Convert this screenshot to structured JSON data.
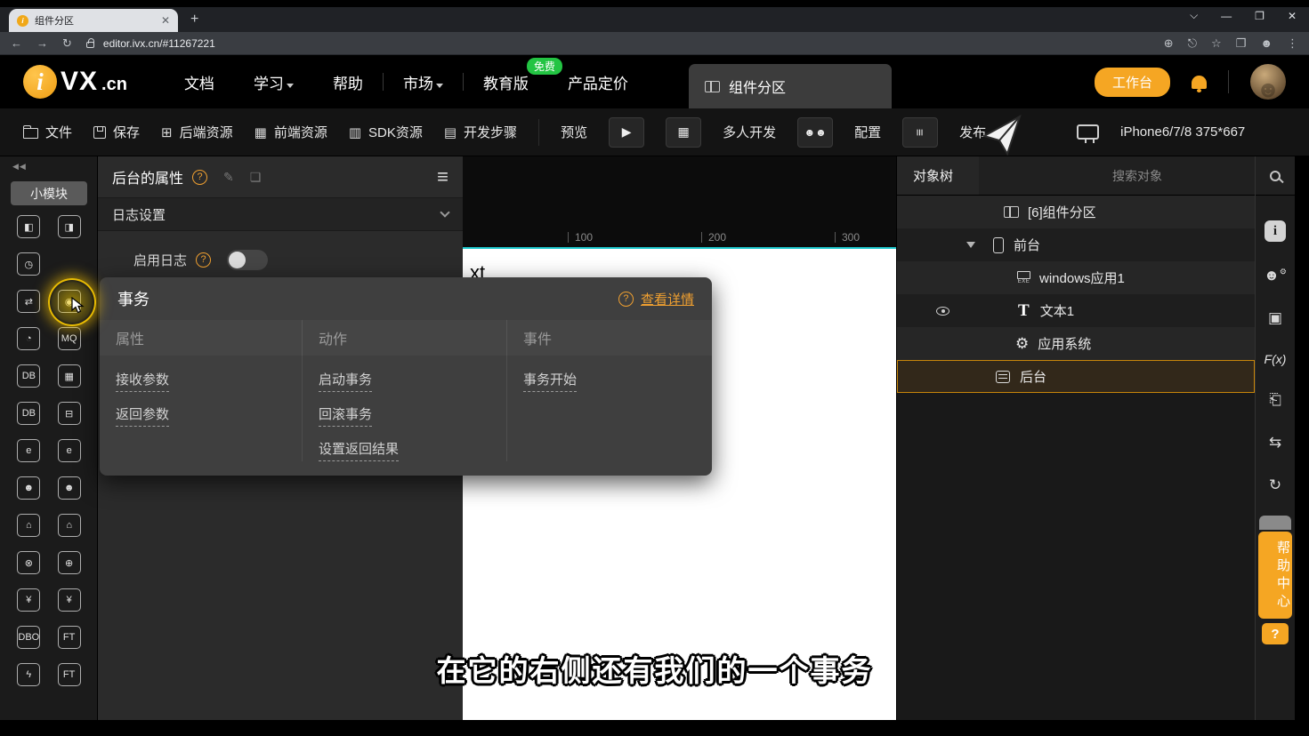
{
  "colors": {
    "accent": "#f5a623",
    "green": "#23c443",
    "selected_border": "#c8860a",
    "cyan": "#1fc9ce"
  },
  "browser": {
    "tab_title": "组件分区",
    "url": "editor.ivx.cn/#11267221"
  },
  "topnav": {
    "logo_i": "i",
    "logo_text": "VX",
    "logo_suffix": ".cn",
    "menu": [
      {
        "label": "文档"
      },
      {
        "label": "学习"
      },
      {
        "label": "帮助"
      },
      {
        "label": "市场"
      },
      {
        "label": "教育版",
        "badge": "免费"
      },
      {
        "label": "产品定价"
      }
    ],
    "active_tab": "组件分区",
    "workbench": "工作台"
  },
  "toolbar": {
    "file": "文件",
    "save": "保存",
    "backend": "后端资源",
    "frontend": "前端资源",
    "sdk": "SDK资源",
    "steps": "开发步骤",
    "preview": "预览",
    "multi_dev": "多人开发",
    "config": "配置",
    "publish": "发布",
    "device": "iPhone6/7/8 375*667"
  },
  "sidebar": {
    "title": "小模块",
    "icon_rows": [
      [
        "◧",
        "◨"
      ],
      [
        "◷",
        ""
      ],
      [
        "⇄",
        "◉"
      ],
      [
        "◔",
        "MQ"
      ],
      [
        "DB",
        "▦"
      ],
      [
        "DB",
        "⊟"
      ],
      [
        "e",
        "e"
      ],
      [
        "☻",
        "☻"
      ],
      [
        "⌂",
        "⌂"
      ],
      [
        "⊗",
        "⊕"
      ],
      [
        "¥",
        "¥"
      ],
      [
        "DBO",
        "FT"
      ],
      [
        "ϟ",
        "FT"
      ]
    ]
  },
  "properties": {
    "title": "后台的属性",
    "section": "日志设置",
    "toggle_label": "启用日志"
  },
  "popup": {
    "title": "事务",
    "detail_link": "查看详情",
    "columns": [
      "属性",
      "动作",
      "事件"
    ],
    "props": [
      "接收参数",
      "返回参数"
    ],
    "actions": [
      "启动事务",
      "回滚事务",
      "设置返回结果"
    ],
    "events": [
      "事务开始"
    ]
  },
  "canvas": {
    "ruler": [
      "100",
      "200",
      "300"
    ],
    "partial_text": "xt"
  },
  "object_tree": {
    "title": "对象树",
    "search_placeholder": "搜索对象",
    "items": [
      {
        "label": "[6]组件分区"
      },
      {
        "label": "前台"
      },
      {
        "label": "windows应用1",
        "icon_label": "EXE"
      },
      {
        "label": "文本1",
        "icon_label": "T"
      },
      {
        "label": "应用系统"
      },
      {
        "label": "后台"
      }
    ]
  },
  "right_strip": {
    "fx": "F(x)",
    "help_center": "帮助中心",
    "help_q": "?"
  },
  "subtitle": "在它的右侧还有我们的一个事务"
}
